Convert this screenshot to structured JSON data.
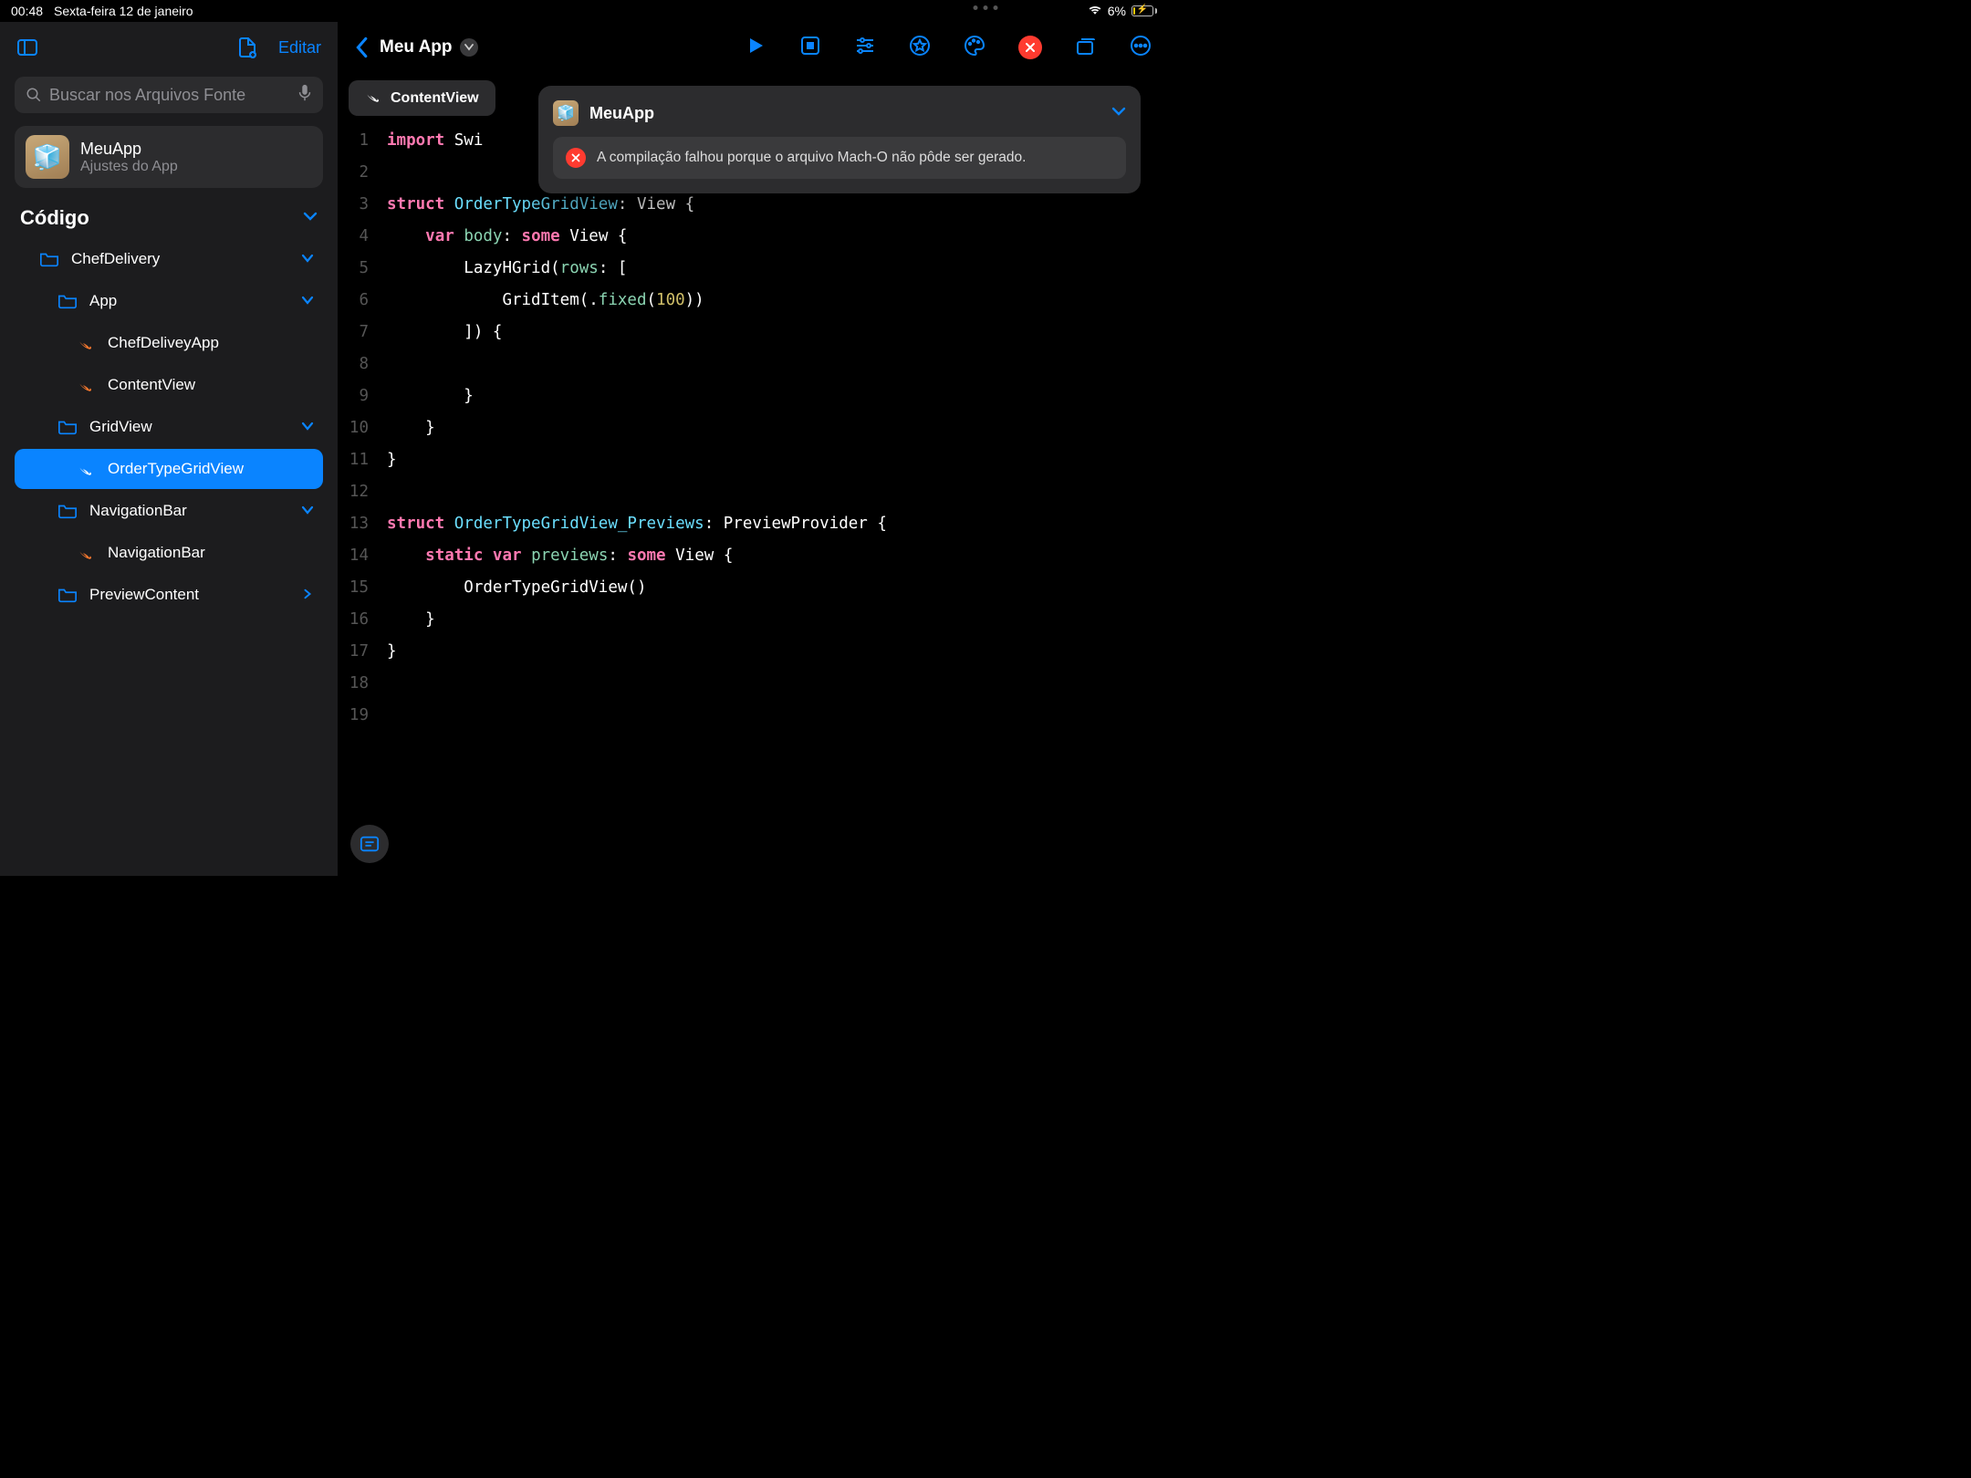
{
  "status": {
    "time": "00:48",
    "date": "Sexta-feira 12 de janeiro",
    "battery_percent": "6%"
  },
  "sidebar": {
    "edit_label": "Editar",
    "search_placeholder": "Buscar nos Arquivos Fonte",
    "app": {
      "title": "MeuApp",
      "subtitle": "Ajustes do App"
    },
    "section_code": "Código",
    "items": {
      "chefdelivery": "ChefDelivery",
      "app_folder": "App",
      "chefdeliveyapp": "ChefDeliveyApp",
      "contentview": "ContentView",
      "gridview": "GridView",
      "ordertypegridview": "OrderTypeGridView",
      "navigationbar_folder": "NavigationBar",
      "navigationbar_file": "NavigationBar",
      "previewcontent": "PreviewContent"
    }
  },
  "editor": {
    "breadcrumb": "Meu App",
    "tab": "ContentView"
  },
  "popover": {
    "title": "MeuApp",
    "issue": "A compilação falhou porque o arquivo Mach-O não pôde ser gerado."
  },
  "code": {
    "lines": [
      {
        "n": 1,
        "html": "<span class='tok-key'>import</span> <span class='tok-plain'>Swi</span>"
      },
      {
        "n": 2,
        "html": ""
      },
      {
        "n": 3,
        "html": "<span class='tok-key'>struct</span> <span class='tok-name'>OrderTypeGridView</span><span class='tok-plain'>: View {</span>"
      },
      {
        "n": 4,
        "html": "    <span class='tok-key'>var</span> <span class='tok-func'>body</span><span class='tok-plain'>: </span><span class='tok-key'>some</span><span class='tok-plain'> View {</span>"
      },
      {
        "n": 5,
        "html": "        <span class='tok-plain'>LazyHGrid(</span><span class='tok-func'>rows</span><span class='tok-plain'>: [</span>"
      },
      {
        "n": 6,
        "html": "            <span class='tok-plain'>GridItem(.</span><span class='tok-func'>fixed</span><span class='tok-plain'>(</span><span class='tok-num'>100</span><span class='tok-plain'>))</span>"
      },
      {
        "n": 7,
        "html": "        <span class='tok-plain'>]) {</span>"
      },
      {
        "n": 8,
        "html": ""
      },
      {
        "n": 9,
        "html": "        <span class='tok-plain'>}</span>"
      },
      {
        "n": 10,
        "html": "    <span class='tok-plain'>}</span>"
      },
      {
        "n": 11,
        "html": "<span class='tok-plain'>}</span>"
      },
      {
        "n": 12,
        "html": ""
      },
      {
        "n": 13,
        "html": "<span class='tok-key'>struct</span> <span class='tok-name'>OrderTypeGridView_Previews</span><span class='tok-plain'>: PreviewProvider {</span>"
      },
      {
        "n": 14,
        "html": "    <span class='tok-kwmod'>static</span> <span class='tok-key'>var</span> <span class='tok-func'>previews</span><span class='tok-plain'>: </span><span class='tok-key'>some</span><span class='tok-plain'> View {</span>"
      },
      {
        "n": 15,
        "html": "        <span class='tok-plain'>OrderTypeGridView()</span>"
      },
      {
        "n": 16,
        "html": "    <span class='tok-plain'>}</span>"
      },
      {
        "n": 17,
        "html": "<span class='tok-plain'>}</span>"
      },
      {
        "n": 18,
        "html": ""
      },
      {
        "n": 19,
        "html": ""
      }
    ]
  }
}
